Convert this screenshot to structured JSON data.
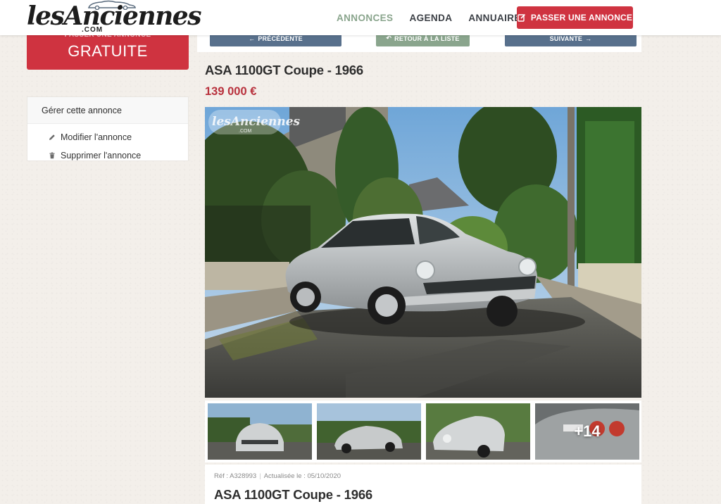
{
  "brand": {
    "logo_text": "lesAnciennes",
    "logo_suffix": ".COM"
  },
  "nav": {
    "links": [
      {
        "label": "ANNONCES",
        "active": true
      },
      {
        "label": "AGENDA",
        "active": false
      },
      {
        "label": "ANNUAIRE",
        "active": false
      }
    ],
    "cta_label": "PASSER UNE ANNONCE",
    "cta_icon": "edit-icon",
    "accent_color": "#cf3340",
    "active_color": "#8aa58d"
  },
  "sidebar": {
    "promo_top": "PASSER UNE ANNONCE",
    "promo_main": "GRATUITE",
    "manage_title": "Gérer cette annonce",
    "manage_items": [
      {
        "label": "Modifier l'annonce",
        "icon": "pencil-icon"
      },
      {
        "label": "Supprimer l'annonce",
        "icon": "trash-icon"
      }
    ]
  },
  "pager": {
    "prev": "PRÉCÉDENTE",
    "list": "RETOUR À LA LISTE",
    "next": "SUIVANTE"
  },
  "listing": {
    "title": "ASA 1100GT Coupe - 1966",
    "price": "139 000 €",
    "price_color": "#b8303c",
    "watermark": "lesAnciennes",
    "watermark_suffix": ".COM",
    "thumbnails_more": "+14",
    "ref": "Réf : A328993",
    "updated": "Actualisée le : 05/10/2020",
    "info_title": "ASA 1100GT Coupe - 1966"
  }
}
